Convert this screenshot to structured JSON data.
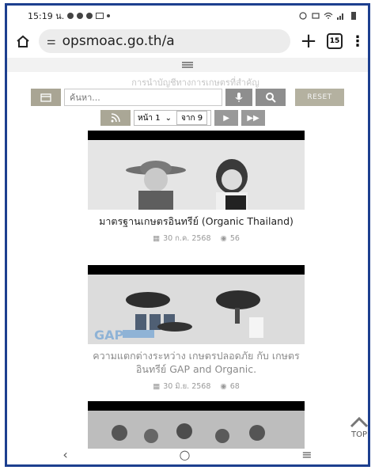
{
  "status": {
    "time": "15:19 น."
  },
  "browser": {
    "url": "opsmoac.go.th/a",
    "tab_count": "15"
  },
  "page": {
    "faded_title": "การนำบัญชีทางการเกษตรที่สำคัญ",
    "search_placeholder": "ค้นหา...",
    "reset_label": "RESET",
    "page_label": "หน้า 1",
    "page_of": "จาก 9"
  },
  "cards": [
    {
      "title": "มาตรฐานเกษตรอินทรีย์ (Organic Thailand)",
      "date": "30 ก.ค. 2568",
      "views": "56"
    },
    {
      "title": "ความแตกต่างระหว่าง เกษตรปลอดภัย กับ เกษตรอินทรีย์ GAP and Organic.",
      "date": "30 มิ.ย. 2568",
      "views": "68",
      "thumb_text": "GAP"
    }
  ],
  "top_label": "TOP"
}
